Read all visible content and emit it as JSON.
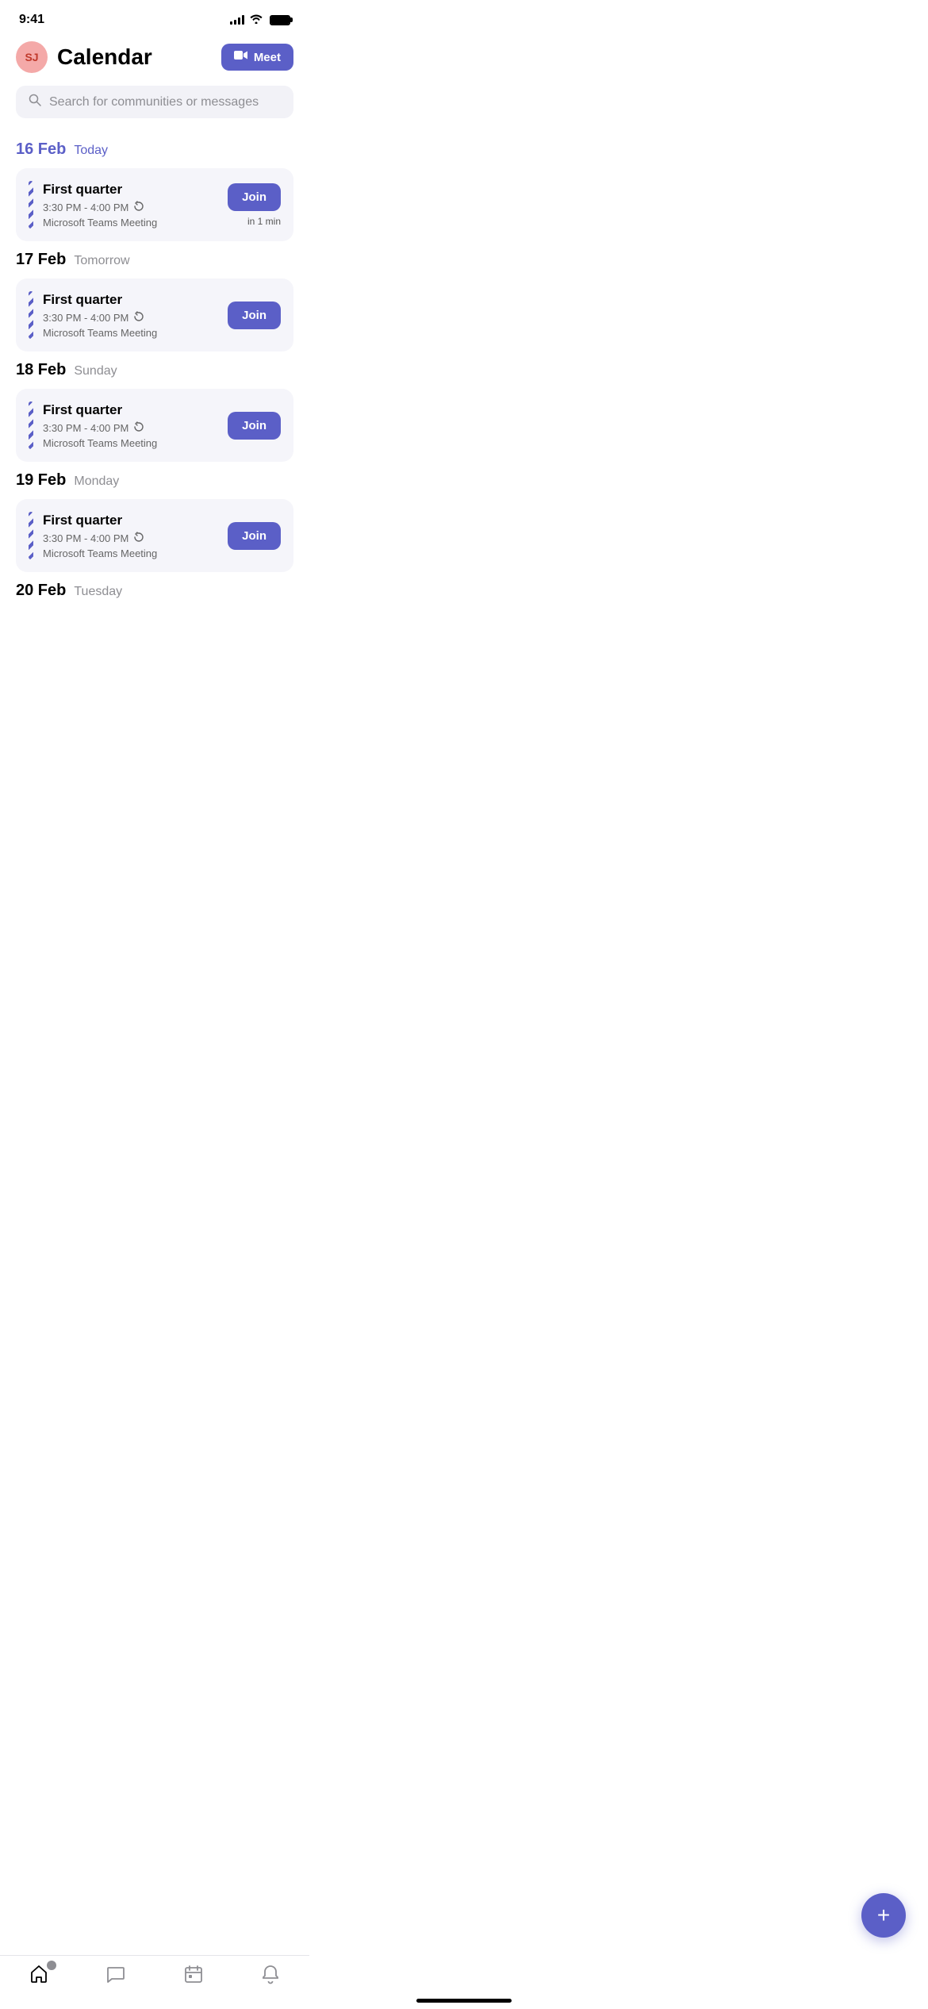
{
  "status": {
    "time": "9:41",
    "signal_bars": [
      3,
      5,
      7,
      9,
      11
    ],
    "battery_full": true
  },
  "header": {
    "avatar_initials": "SJ",
    "title": "Calendar",
    "meet_button_label": "Meet"
  },
  "search": {
    "placeholder": "Search for communities or messages"
  },
  "dates": [
    {
      "date": "16 Feb",
      "label": "Today",
      "is_today": true,
      "events": [
        {
          "title": "First quarter",
          "time": "3:30 PM - 4:00 PM",
          "recurring": true,
          "subtitle": "Microsoft Teams Meeting",
          "has_join": true,
          "in_time": "in 1 min"
        }
      ]
    },
    {
      "date": "17 Feb",
      "label": "Tomorrow",
      "is_today": false,
      "events": [
        {
          "title": "First quarter",
          "time": "3:30 PM - 4:00 PM",
          "recurring": true,
          "subtitle": "Microsoft Teams Meeting",
          "has_join": true,
          "in_time": null
        }
      ]
    },
    {
      "date": "18 Feb",
      "label": "Sunday",
      "is_today": false,
      "events": [
        {
          "title": "First quarter",
          "time": "3:30 PM - 4:00 PM",
          "recurring": true,
          "subtitle": "Microsoft Teams Meeting",
          "has_join": true,
          "in_time": null
        }
      ]
    },
    {
      "date": "19 Feb",
      "label": "Monday",
      "is_today": false,
      "events": [
        {
          "title": "First quarter",
          "time": "3:30 PM - 4:00 PM",
          "recurring": true,
          "subtitle": "Microsoft Teams Meeting",
          "has_join": true,
          "in_time": null
        }
      ]
    },
    {
      "date": "20 Feb",
      "label": "Tuesday",
      "is_today": false,
      "events": []
    }
  ],
  "nav": {
    "items": [
      {
        "icon": "🏠",
        "label": "home",
        "active": false,
        "badge": true
      },
      {
        "icon": "💬",
        "label": "chat",
        "active": false,
        "badge": false
      },
      {
        "icon": "📅",
        "label": "calendar",
        "active": true,
        "badge": false
      },
      {
        "icon": "🔔",
        "label": "notifications",
        "active": false,
        "badge": false
      }
    ]
  },
  "fab": {
    "label": "+"
  },
  "colors": {
    "accent": "#5b5fc7",
    "today": "#5b5fc7",
    "card_bg": "#f5f5fa"
  }
}
